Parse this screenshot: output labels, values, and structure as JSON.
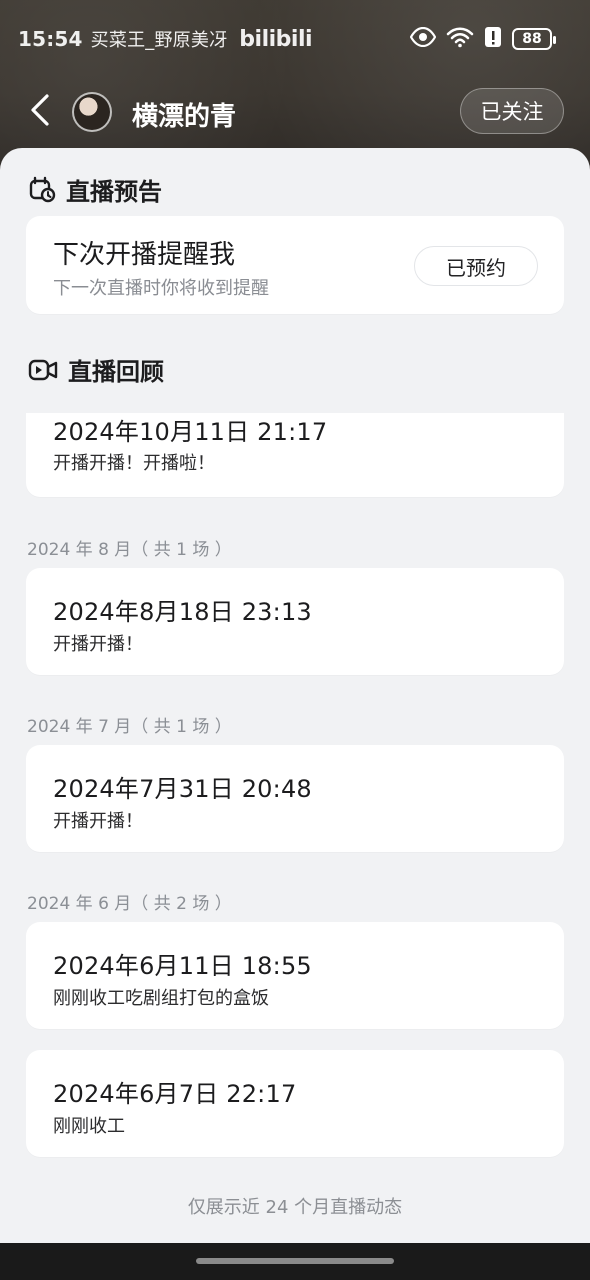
{
  "status_bar": {
    "time": "15:54",
    "notification_text": "买菜王_野原美冴",
    "app_logo_text": "bilibili",
    "battery": "88"
  },
  "header": {
    "channel_name": "横漂的青",
    "follow_button": "已关注"
  },
  "live_notice": {
    "section_title": "直播预告",
    "card_title": "下次开播提醒我",
    "card_subtitle": "下一次直播时你将收到提醒",
    "reserve_button": "已预约"
  },
  "live_replay": {
    "section_title": "直播回顾",
    "partial_card": {
      "when": "2024年10月11日 21:17",
      "desc": "开播开播！开播啦！"
    },
    "months": [
      {
        "label": "2024 年 8 月（ 共 1 场 ）",
        "items": [
          {
            "when": "2024年8月18日 23:13",
            "desc": "开播开播！"
          }
        ]
      },
      {
        "label": "2024 年 7 月（ 共 1 场 ）",
        "items": [
          {
            "when": "2024年7月31日 20:48",
            "desc": "开播开播！"
          }
        ]
      },
      {
        "label": "2024 年 6 月（ 共 2 场 ）",
        "items": [
          {
            "when": "2024年6月11日 18:55",
            "desc": "刚刚收工吃剧组打包的盒饭"
          },
          {
            "when": "2024年6月7日 22:17",
            "desc": "刚刚收工"
          }
        ]
      }
    ]
  },
  "footer_note": "仅展示近 24 个月直播动态",
  "icons": {
    "back": "chevron-left-icon",
    "eye": "eye-icon",
    "wifi": "wifi-icon",
    "alert": "alert-icon",
    "notice": "calendar-clock-icon",
    "replay": "video-replay-icon"
  }
}
